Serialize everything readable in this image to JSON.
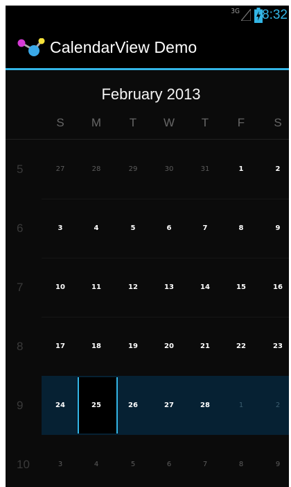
{
  "status_bar": {
    "network": "3G",
    "time": "8:32",
    "icons": [
      "signal-icon",
      "battery-charging-icon"
    ],
    "accent_color": "#33b5e5"
  },
  "action_bar": {
    "title": "CalendarView Demo",
    "app_icon": "molecule-app-icon"
  },
  "calendar": {
    "month_title": "February 2013",
    "weekday_headers": [
      "S",
      "M",
      "T",
      "W",
      "T",
      "F",
      "S"
    ],
    "selected_date": "25",
    "weeks": [
      {
        "number": "5",
        "days": [
          "27",
          "28",
          "29",
          "30",
          "31",
          "1",
          "2"
        ],
        "current_month": [
          false,
          false,
          false,
          false,
          false,
          true,
          true
        ]
      },
      {
        "number": "6",
        "days": [
          "3",
          "4",
          "5",
          "6",
          "7",
          "8",
          "9"
        ],
        "current_month": [
          true,
          true,
          true,
          true,
          true,
          true,
          true
        ]
      },
      {
        "number": "7",
        "days": [
          "10",
          "11",
          "12",
          "13",
          "14",
          "15",
          "16"
        ],
        "current_month": [
          true,
          true,
          true,
          true,
          true,
          true,
          true
        ]
      },
      {
        "number": "8",
        "days": [
          "17",
          "18",
          "19",
          "20",
          "21",
          "22",
          "23"
        ],
        "current_month": [
          true,
          true,
          true,
          true,
          true,
          true,
          true
        ]
      },
      {
        "number": "9",
        "days": [
          "24",
          "25",
          "26",
          "27",
          "28",
          "1",
          "2"
        ],
        "current_month": [
          true,
          true,
          true,
          true,
          true,
          false,
          false
        ],
        "selected": true
      },
      {
        "number": "10",
        "days": [
          "3",
          "4",
          "5",
          "6",
          "7",
          "8",
          "9"
        ],
        "current_month": [
          false,
          false,
          false,
          false,
          false,
          false,
          false
        ]
      }
    ]
  }
}
